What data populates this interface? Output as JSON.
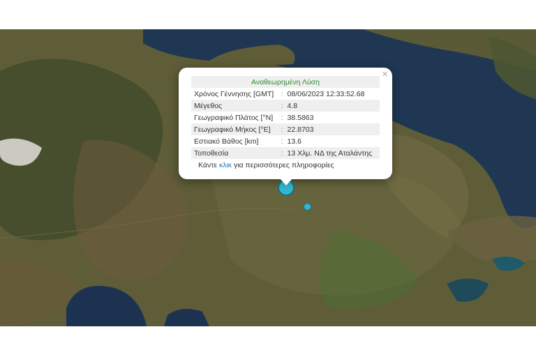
{
  "popup": {
    "title": "Αναθεωρημένη Λύση",
    "rows": [
      {
        "label": "Χρόνος Γέννησης [GMT]",
        "value": "08/06/2023 12:33:52.68"
      },
      {
        "label": "Μέγεθος",
        "value": "4.8"
      },
      {
        "label": "Γεωγραφικό Πλάτος [°N]",
        "value": "38.5863"
      },
      {
        "label": "Γεωγραφικό Μήκος [°E]",
        "value": "22.8703"
      },
      {
        "label": "Εστιακό Βάθος [km]",
        "value": "13.6"
      },
      {
        "label": "Τοποθεσία",
        "value": "13 Χλμ. ΝΔ της Αταλάντης"
      }
    ],
    "separator": ":",
    "more_prefix": "Κάντε ",
    "more_link": "κλικ",
    "more_suffix": " για περισσότερες πληροφορίες",
    "close": "×"
  },
  "map": {
    "sea_color": "#1f3753",
    "land_color": "#5b5a36",
    "marker_color": "#33b6cf"
  }
}
